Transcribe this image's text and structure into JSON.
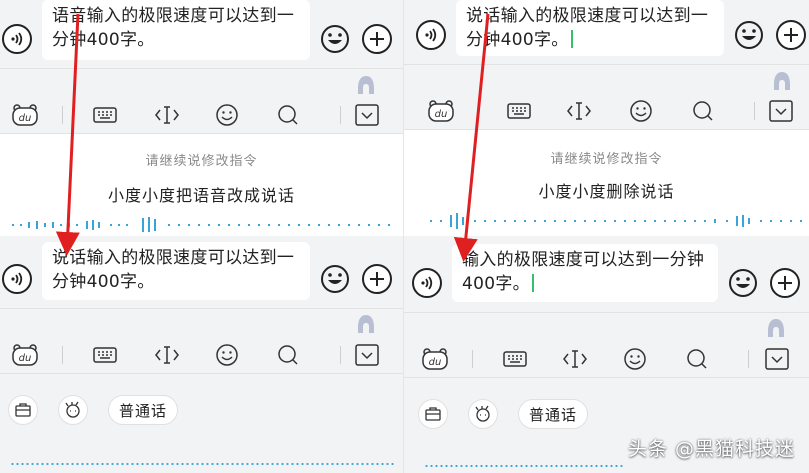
{
  "panels": {
    "top_left": {
      "message": "语音输入的极限速度可以达到一分钟400字。",
      "prompt": "请继续说修改指令",
      "command": "小度小度把语音改成说话"
    },
    "bottom_left": {
      "message": "说话输入的极限速度可以达到一分钟400字。",
      "quick_phrase": "普通话"
    },
    "top_right": {
      "message": "说话输入的极限速度可以达到一分钟400字。",
      "prompt": "请继续说修改指令",
      "command": "小度小度删除说话"
    },
    "bottom_right": {
      "message": "输入的极限速度可以达到一分钟400字。",
      "quick_phrase": "普通话"
    }
  },
  "toolbar": {
    "icons": [
      "du-logo-icon",
      "keyboard-icon",
      "cursor-move-icon",
      "emoji-icon",
      "search-icon",
      "collapse-icon"
    ],
    "logo_text": "du"
  },
  "watermark": "头条 @黑猫科技迷",
  "colors": {
    "arrow": "#e02020",
    "cursor": "#35c06b",
    "wave": "#3aa3d8",
    "background": "#f2f3f5"
  }
}
